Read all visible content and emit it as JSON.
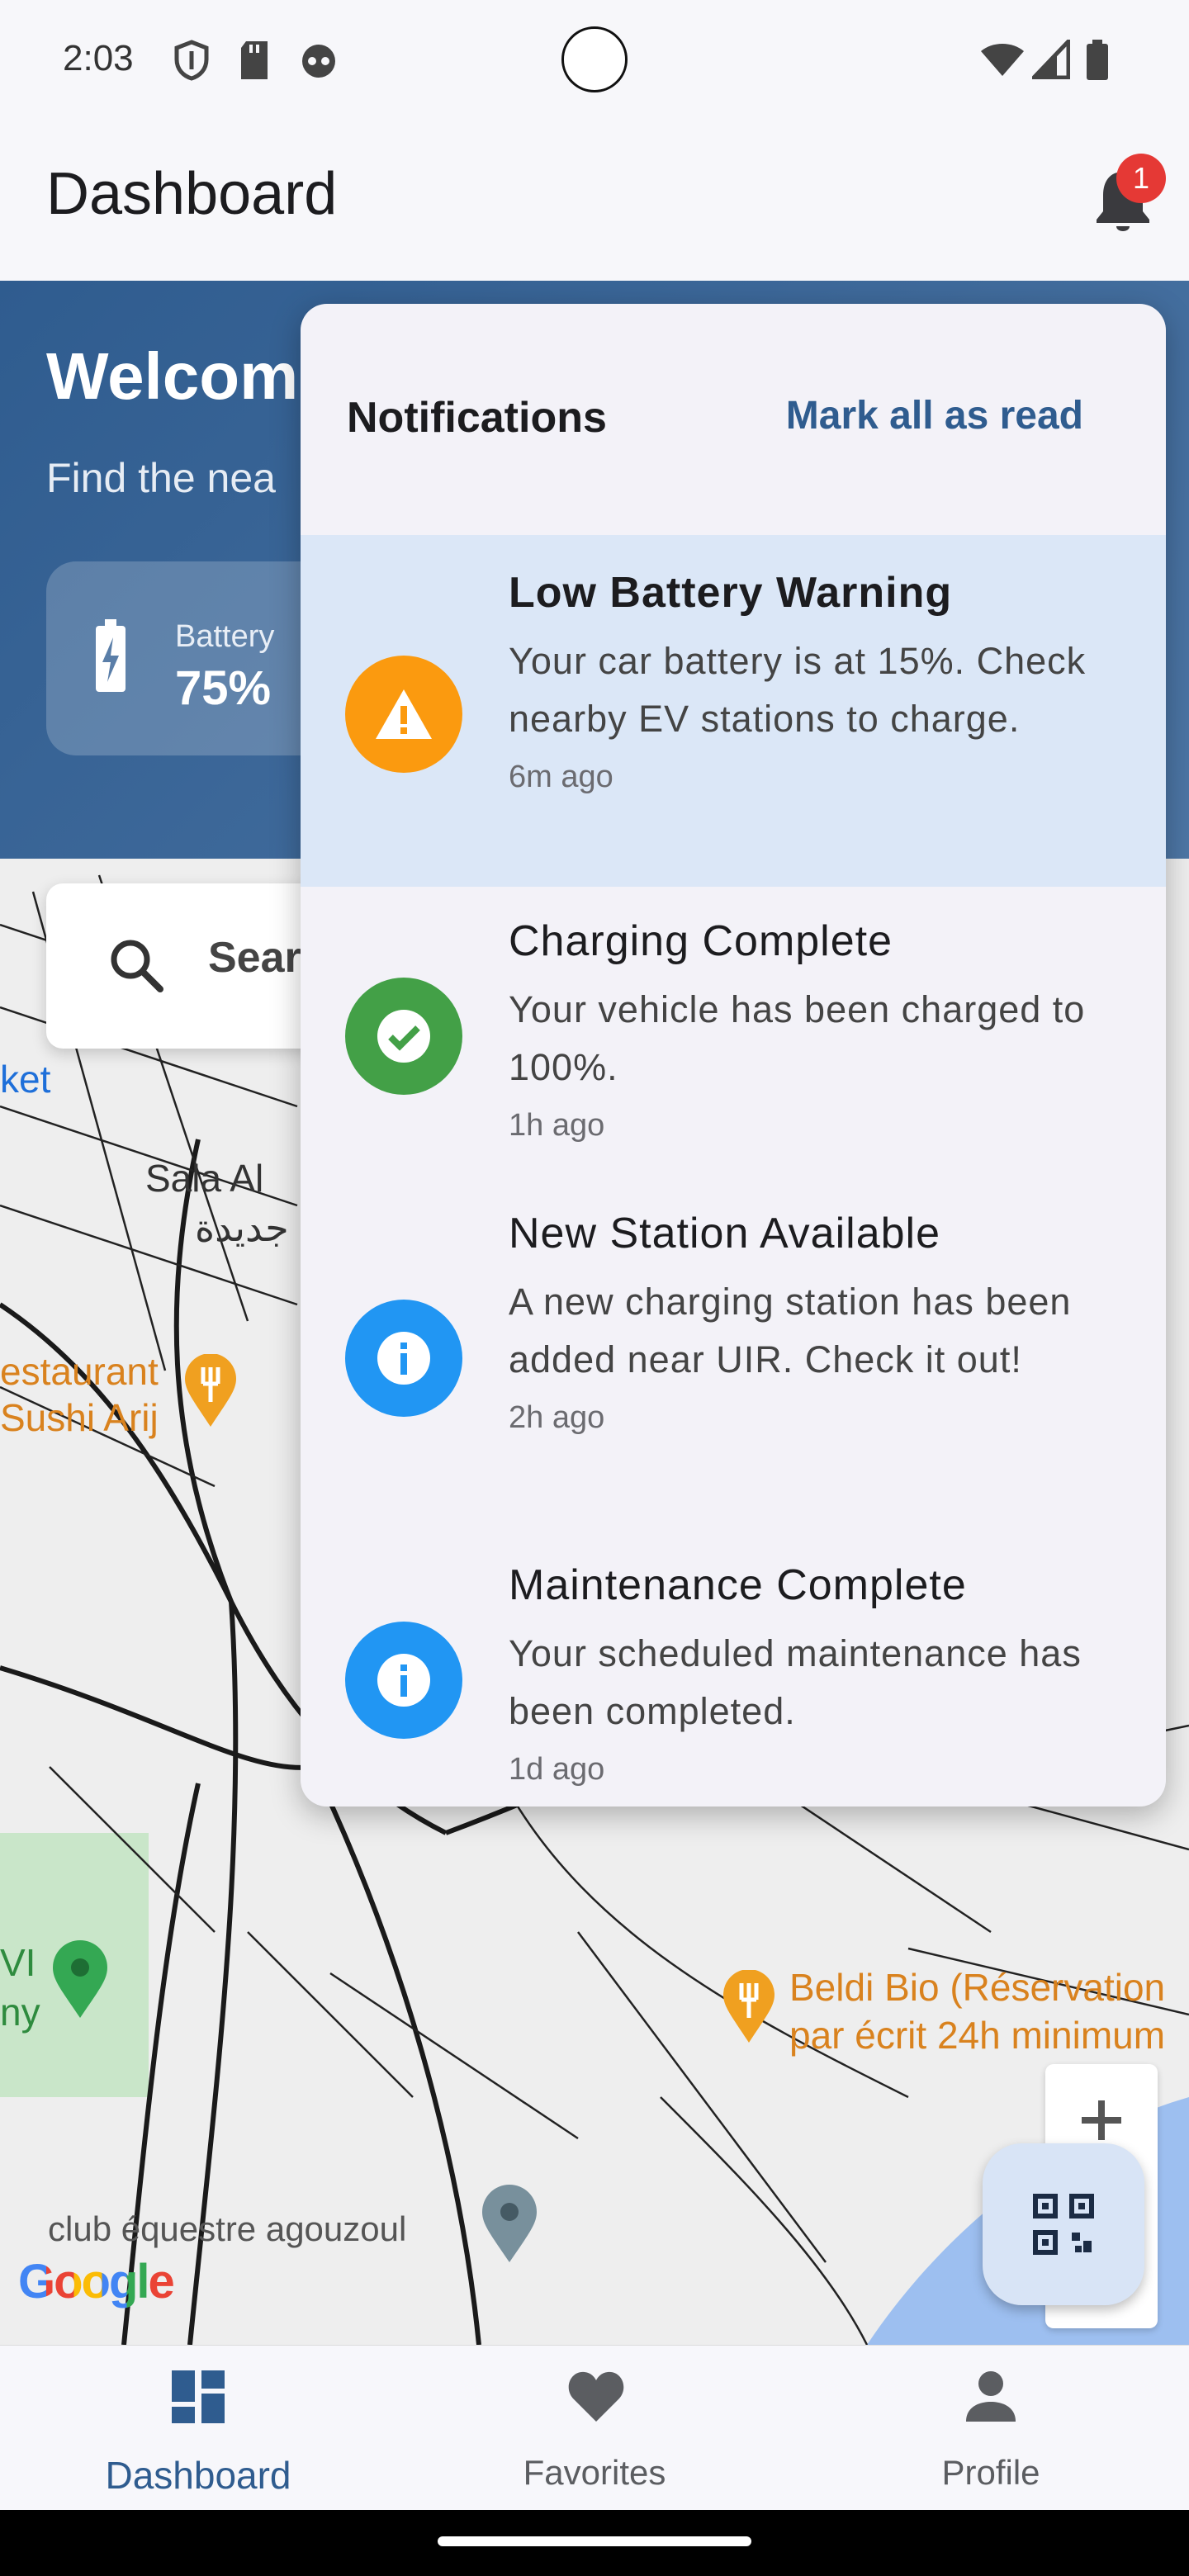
{
  "status": {
    "time": "2:03"
  },
  "appbar": {
    "title": "Dashboard",
    "badge_count": "1"
  },
  "header": {
    "welcome": "Welcom",
    "find": "Find the nea",
    "battery": {
      "label": "Battery",
      "value": "75%"
    }
  },
  "map": {
    "search_placeholder": "Sear",
    "labels": [
      {
        "text": "ket"
      },
      {
        "text": "Sala Al"
      },
      {
        "text": "جديدة"
      },
      {
        "text": "estaurant"
      },
      {
        "text": "Sushi Arij"
      },
      {
        "text": "Beldi Bio (Réservation"
      },
      {
        "text": "par écrit 24h minimum"
      },
      {
        "text": "VI"
      },
      {
        "text": "ny"
      },
      {
        "text": "club équestre agouzoul"
      }
    ],
    "google": "Google"
  },
  "notifications": {
    "title": "Notifications",
    "mark_all": "Mark all as read",
    "items": [
      {
        "title": "Low Battery Warning",
        "message": "Your car battery is at 15%. Check nearby EV stations to charge.",
        "time": "6m ago",
        "type": "warning",
        "color": "#fb9a0f"
      },
      {
        "title": "Charging Complete",
        "message": "Your vehicle has been charged to 100%.",
        "time": "1h ago",
        "type": "success",
        "color": "#43a047"
      },
      {
        "title": "New Station Available",
        "message": "A new charging station has been added near UIR. Check it out!",
        "time": "2h ago",
        "type": "info",
        "color": "#2196f3"
      },
      {
        "title": "Maintenance Complete",
        "message": "Your scheduled maintenance has been completed.",
        "time": "1d ago",
        "type": "info",
        "color": "#2196f3"
      }
    ]
  },
  "nav": {
    "items": [
      {
        "label": "Dashboard",
        "icon": "dashboard-icon"
      },
      {
        "label": "Favorites",
        "icon": "heart-icon"
      },
      {
        "label": "Profile",
        "icon": "person-icon"
      }
    ]
  },
  "colors": {
    "primary": "#2f5c8f",
    "unread_bg": "#dbe7f7",
    "badge": "#e53935"
  }
}
